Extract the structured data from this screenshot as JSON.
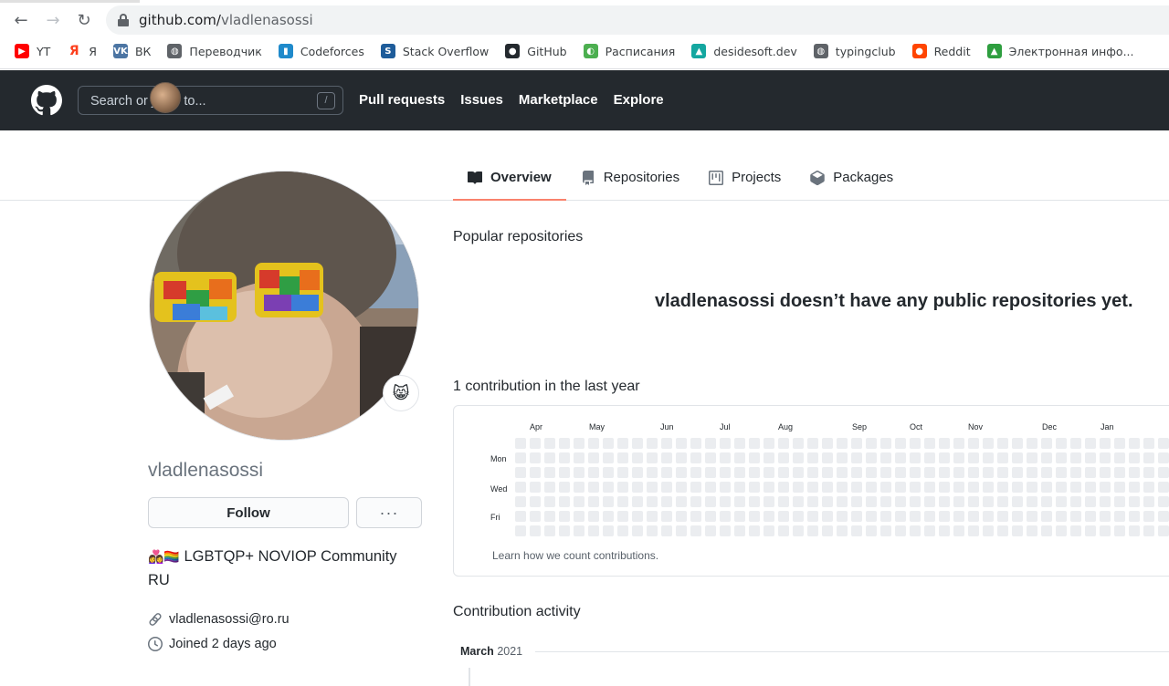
{
  "browser": {
    "url_host": "github.com/",
    "url_path": "vladlenasossi",
    "bookmarks": [
      {
        "label": "YT",
        "icon": "youtube-icon",
        "color": "#ff0000"
      },
      {
        "label": "Я",
        "icon": "yandex-icon",
        "color": "#fc3f1d"
      },
      {
        "label": "ВК",
        "icon": "vk-icon",
        "color": "#4c75a3"
      },
      {
        "label": "Переводчик",
        "icon": "globe-icon",
        "color": "#5f6368"
      },
      {
        "label": "Codeforces",
        "icon": "codeforces-icon",
        "color": "#1f8acb"
      },
      {
        "label": "Stack Overflow",
        "icon": "stackoverflow-icon",
        "color": "#1e5c9a"
      },
      {
        "label": "GitHub",
        "icon": "github-icon",
        "color": "#24292e"
      },
      {
        "label": "Расписания",
        "icon": "schedule-icon",
        "color": "#4caf50"
      },
      {
        "label": "desidesoft.dev",
        "icon": "desidesoft-icon",
        "color": "#14a7a0"
      },
      {
        "label": "typingclub",
        "icon": "globe-icon",
        "color": "#5f6368"
      },
      {
        "label": "Reddit",
        "icon": "reddit-icon",
        "color": "#ff4500"
      },
      {
        "label": "Электронная инфо...",
        "icon": "graduation-cap-icon",
        "color": "#2e9e3f"
      }
    ]
  },
  "header": {
    "search_placeholder": "Search or jump to...",
    "search_shortcut": "/",
    "nav": [
      "Pull requests",
      "Issues",
      "Marketplace",
      "Explore"
    ]
  },
  "tabs": [
    {
      "label": "Overview",
      "icon": "book-icon",
      "active": true
    },
    {
      "label": "Repositories",
      "icon": "repo-icon",
      "active": false
    },
    {
      "label": "Projects",
      "icon": "project-icon",
      "active": false
    },
    {
      "label": "Packages",
      "icon": "package-icon",
      "active": false
    }
  ],
  "profile": {
    "username": "vladlenasossi",
    "status_emoji": "😸",
    "follow_label": "Follow",
    "more_label": "···",
    "bio_emojis": "👩‍❤️‍👩🏳️‍🌈",
    "bio_text": "LGBTQP+ NOVIOP Community RU",
    "email": "vladlenasossi@ro.ru",
    "joined": "Joined 2 days ago"
  },
  "main": {
    "popular_title": "Popular repositories",
    "empty_message": "vladlenasossi doesn’t have any public repositories yet.",
    "contrib_title": "1 contribution in the last year",
    "months": [
      "Apr",
      "May",
      "Jun",
      "Jul",
      "Aug",
      "Sep",
      "Oct",
      "Nov",
      "Dec",
      "Jan"
    ],
    "days": [
      "Mon",
      "Wed",
      "Fri"
    ],
    "learn_link": "Learn how we count contributions.",
    "activity_title": "Contribution activity",
    "activity_month": "March",
    "activity_year": "2021"
  },
  "colors": {
    "header_bg": "#24292e",
    "tab_underline": "#f9826c",
    "cell_empty": "#ebedf0"
  }
}
